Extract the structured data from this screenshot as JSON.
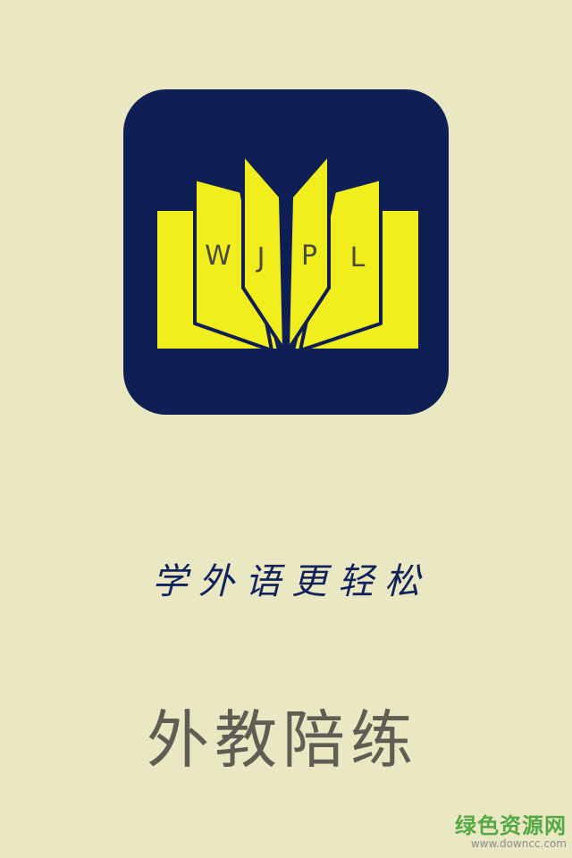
{
  "colors": {
    "background": "#e9e8c3",
    "icon_background": "#0f1f56",
    "book_yellow": "#f0ee1c",
    "book_outline": "#0f1f56",
    "tagline_color": "#12235b",
    "app_name_color": "#5e5e55",
    "watermark_green": "#55a845"
  },
  "logo": {
    "letters": [
      "W",
      "J",
      "P",
      "L"
    ],
    "icon": "open-book-icon"
  },
  "tagline": "学外语更轻松",
  "app_name": "外教陪练",
  "watermark": {
    "site_name": "绿色资源网",
    "url": "www.downcc.com"
  }
}
